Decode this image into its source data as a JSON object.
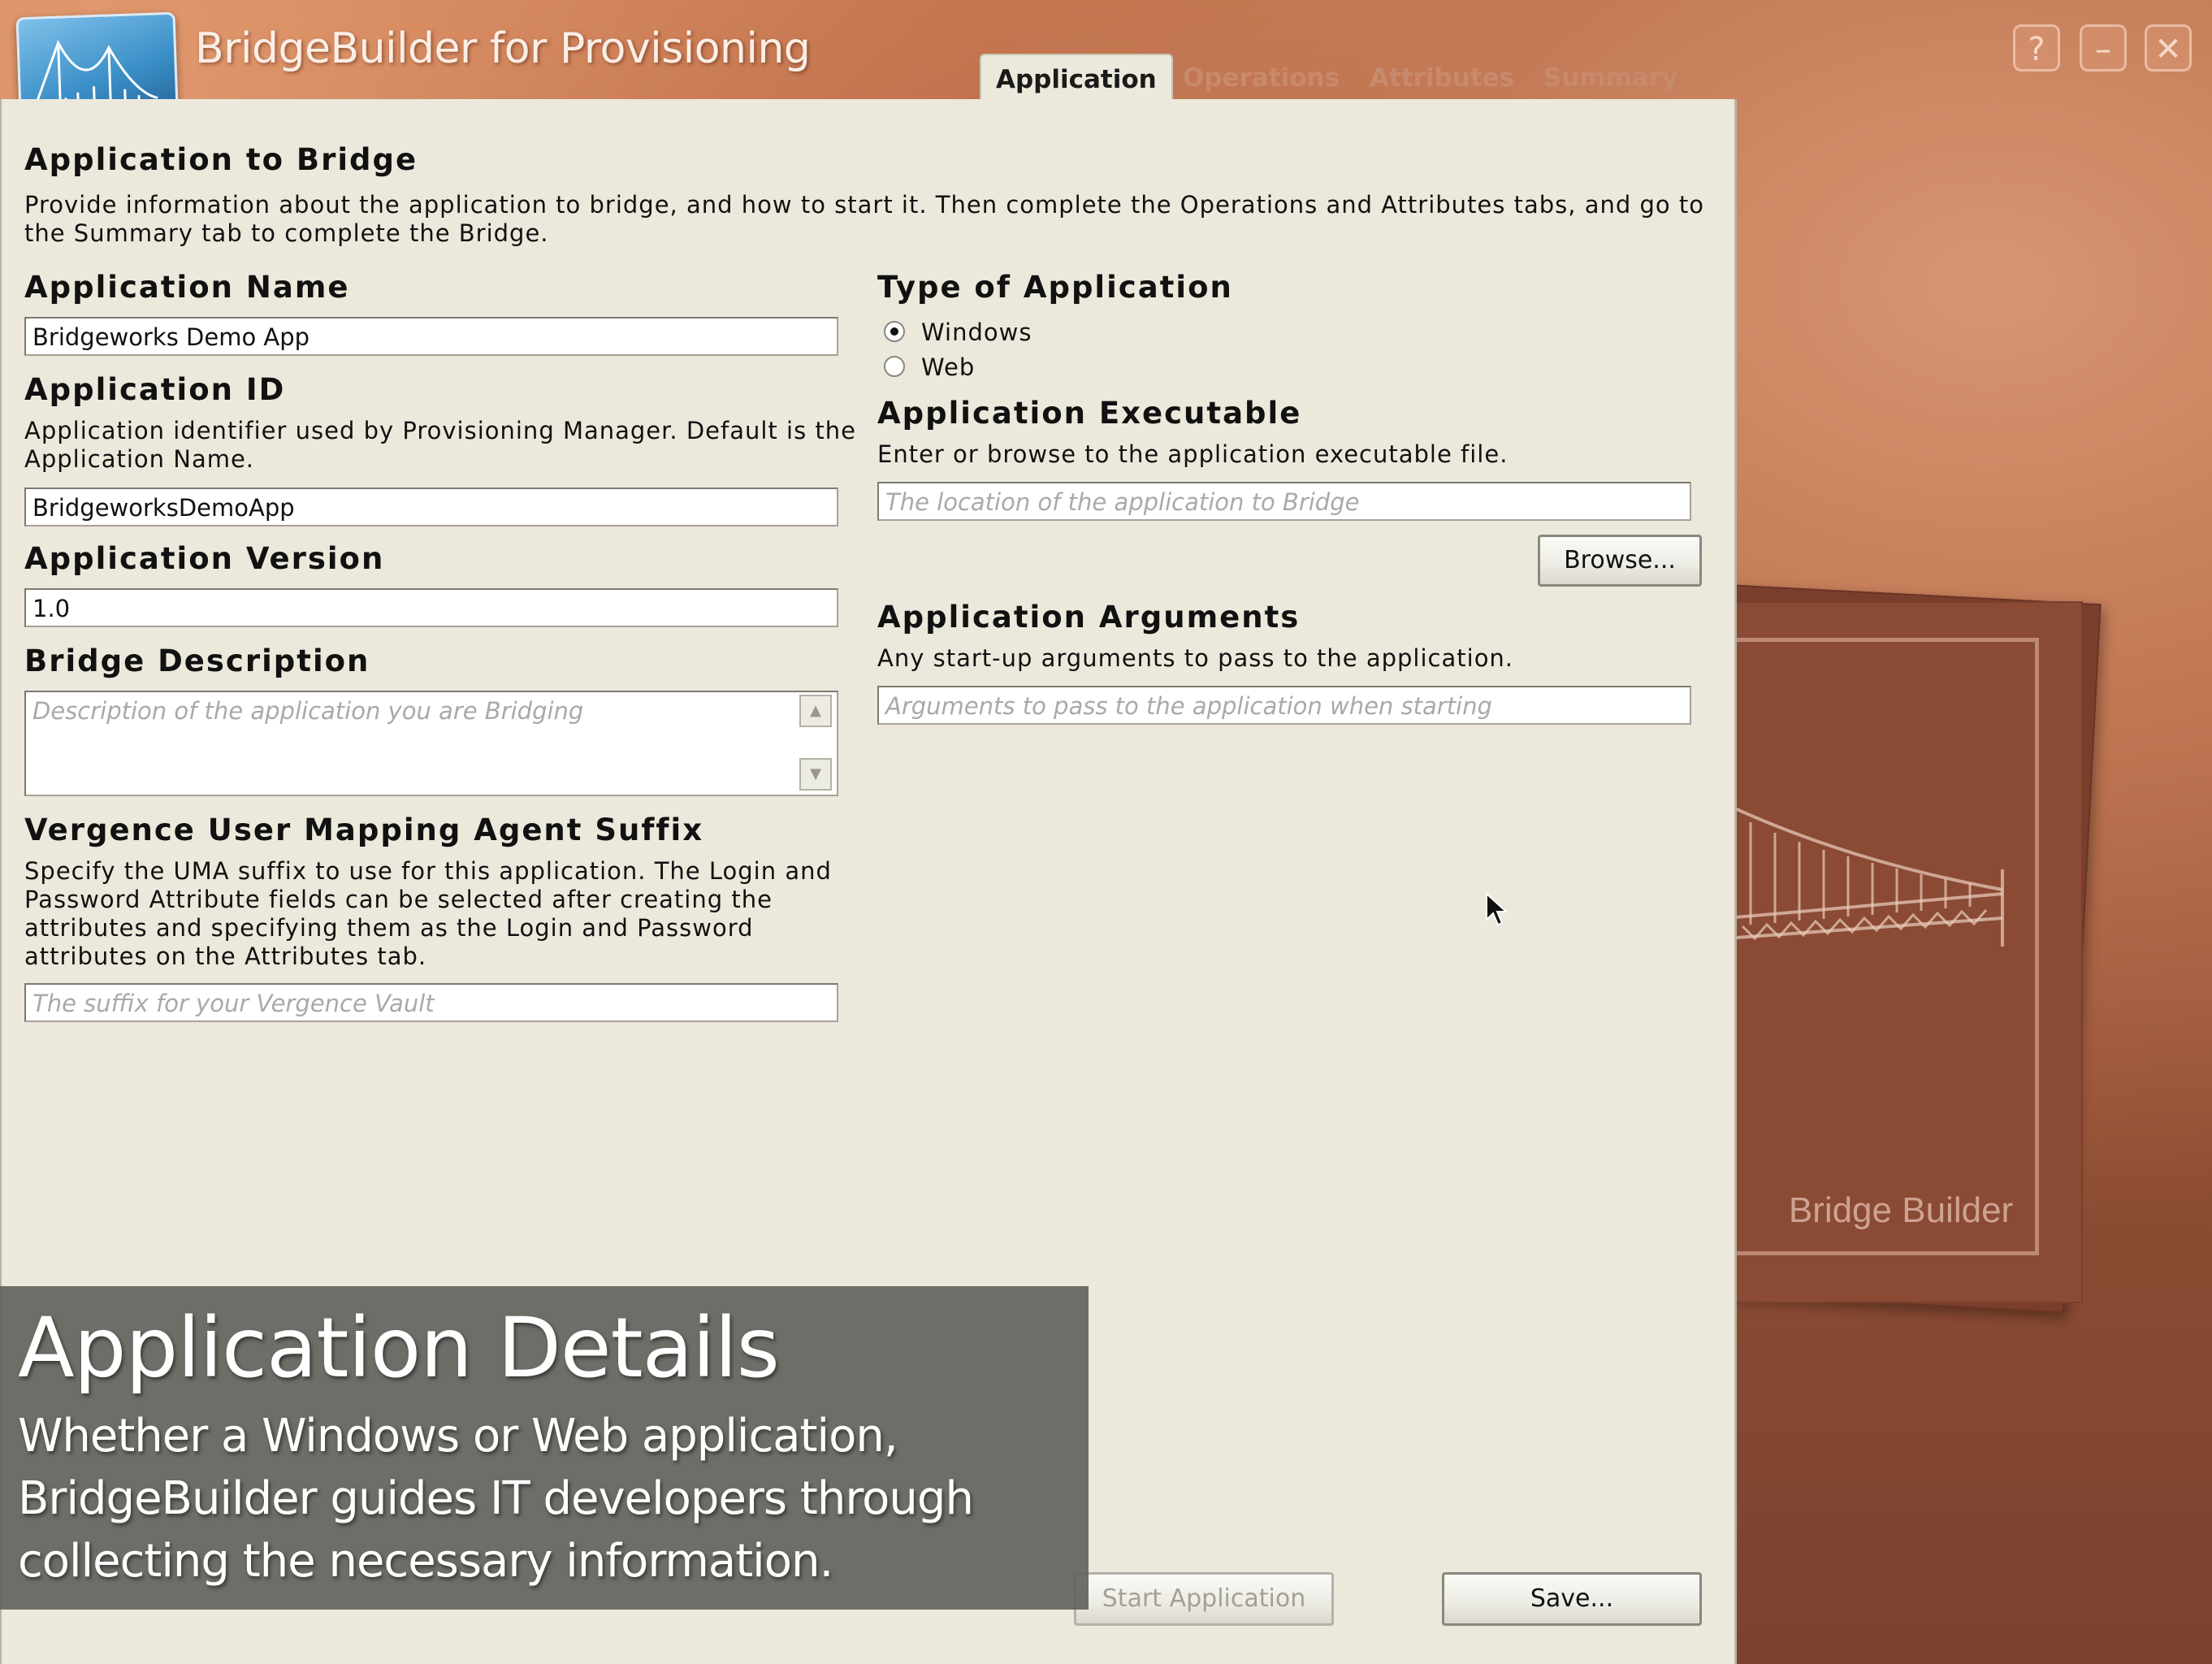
{
  "window": {
    "title": "BridgeBuilder for Provisioning",
    "help_label": "?",
    "minimize_label": "–",
    "close_label": "✕"
  },
  "tabs": [
    "Application",
    "Operations",
    "Attributes",
    "Summary"
  ],
  "intro": {
    "heading": "Application to Bridge",
    "text_line1": "Provide information about the application to bridge, and how to start it. Then complete the Operations and Attributes tabs, and go to",
    "text_line2": "the Summary tab to complete the Bridge."
  },
  "app_name": {
    "label": "Application Name",
    "value": "Bridgeworks Demo App"
  },
  "app_id": {
    "label": "Application ID",
    "help_line1": "Application identifier used by Provisioning Manager. Default is the",
    "help_line2": "Application Name.",
    "value": "BridgeworksDemoApp"
  },
  "app_version": {
    "label": "Application Version",
    "value": "1.0"
  },
  "bridge_description": {
    "label": "Bridge Description",
    "placeholder": "Description of the application you are Bridging"
  },
  "uma_suffix": {
    "label": "Vergence User Mapping Agent Suffix",
    "help_line1": "Specify the UMA suffix to use for this application. The Login and",
    "help_line2": "Password Attribute fields can be selected after creating the",
    "help_line3": "attributes and specifying them as the Login and Password",
    "help_line4": "attributes on the Attributes tab.",
    "placeholder": "The suffix for your Vergence Vault"
  },
  "app_type": {
    "label": "Type of Application",
    "options": [
      "Windows",
      "Web"
    ],
    "selected": "Windows"
  },
  "app_executable": {
    "label": "Application Executable",
    "help": "Enter or browse to the application executable file.",
    "placeholder": "The location of the application to Bridge",
    "browse_label": "Browse..."
  },
  "app_arguments": {
    "label": "Application Arguments",
    "help": "Any start-up arguments to pass to the application.",
    "placeholder": "Arguments to pass to the application when starting"
  },
  "actions": {
    "start_label": "Start Application",
    "save_label": "Save..."
  },
  "background": {
    "card_text": "Bridge Builder"
  },
  "caption": {
    "title": "Application Details",
    "line1": "Whether a Windows or Web application,",
    "line2": "BridgeBuilder guides IT developers through",
    "line3": "collecting the necessary information."
  },
  "colors": {
    "panel": "#ece9dc",
    "chrome": "#a3583a",
    "caption_bg": "#64625c"
  }
}
